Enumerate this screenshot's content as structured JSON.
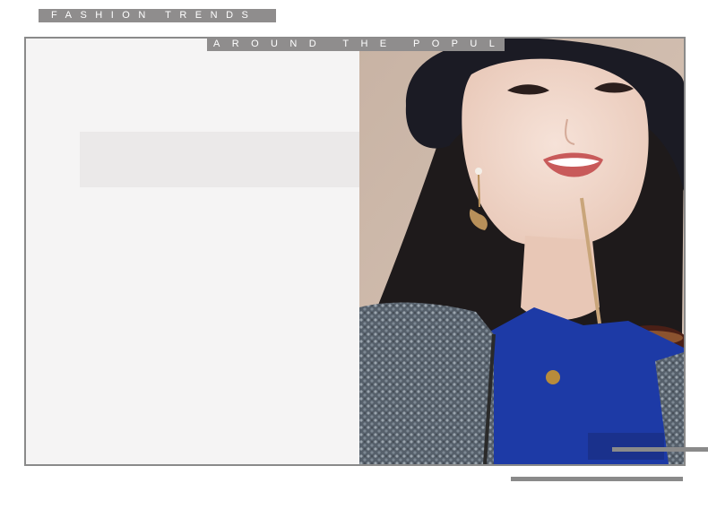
{
  "header": {
    "tag": "FASHION TRENDS"
  },
  "frame": {
    "tag": "AROUND THE POPULAR"
  },
  "photo": {
    "subject": "woman-portrait"
  },
  "colors": {
    "tag_bg": "#8f8d8d",
    "frame_border": "#8a8a8a",
    "panel_bg": "#f5f4f4",
    "placeholder_bg": "#ebe9e9"
  }
}
